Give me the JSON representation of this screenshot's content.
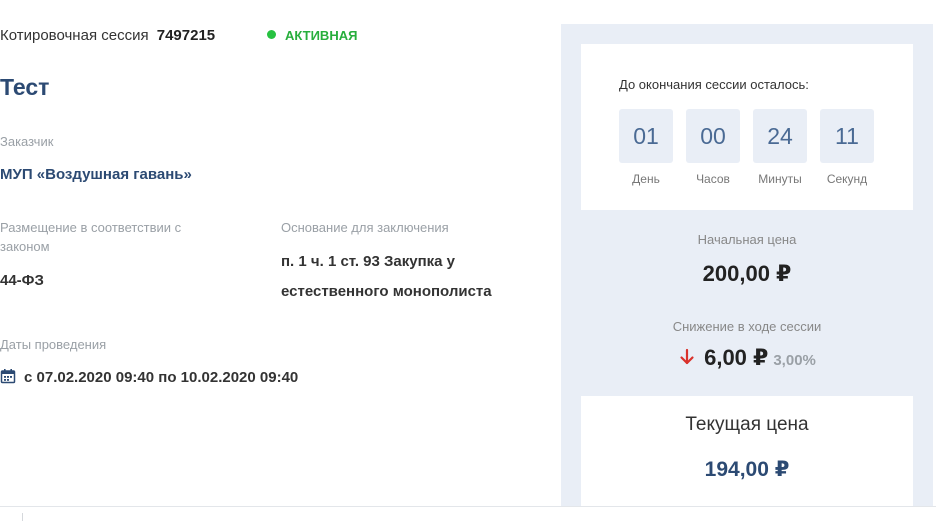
{
  "session": {
    "label": "Котировочная сессия",
    "number": "7497215",
    "status": "АКТИВНАЯ",
    "status_color": "#27ae3c"
  },
  "title": "Тест",
  "customer": {
    "label": "Заказчик",
    "value": "МУП «Воздушная гавань»"
  },
  "placement": {
    "label": "Размещение в соответствии с законом",
    "value": "44-ФЗ"
  },
  "basis": {
    "label": "Основание для заключения",
    "value": "п. 1 ч. 1 ст. 93 Закупка у естественного монополиста"
  },
  "dates": {
    "label": "Даты проведения",
    "value": "с 07.02.2020 09:40 по 10.02.2020 09:40",
    "icon": "calendar-icon"
  },
  "timer": {
    "caption": "До окончания сессии осталось:",
    "cells": [
      {
        "value": "01",
        "label": "День"
      },
      {
        "value": "00",
        "label": "Часов"
      },
      {
        "value": "24",
        "label": "Минуты"
      },
      {
        "value": "11",
        "label": "Секунд"
      }
    ]
  },
  "prices": {
    "initial_label": "Начальная цена",
    "initial_value": "200,00 ₽",
    "reduction_label": "Снижение в ходе сессии",
    "reduction_value": "6,00 ₽",
    "reduction_percent": "3,00%",
    "reduction_icon": "arrow-down-icon",
    "current_label": "Текущая цена",
    "current_value": "194,00 ₽"
  },
  "colors": {
    "accent": "#2c4a73",
    "panel_bg": "#e9eef6",
    "decrease": "#d9312b"
  }
}
